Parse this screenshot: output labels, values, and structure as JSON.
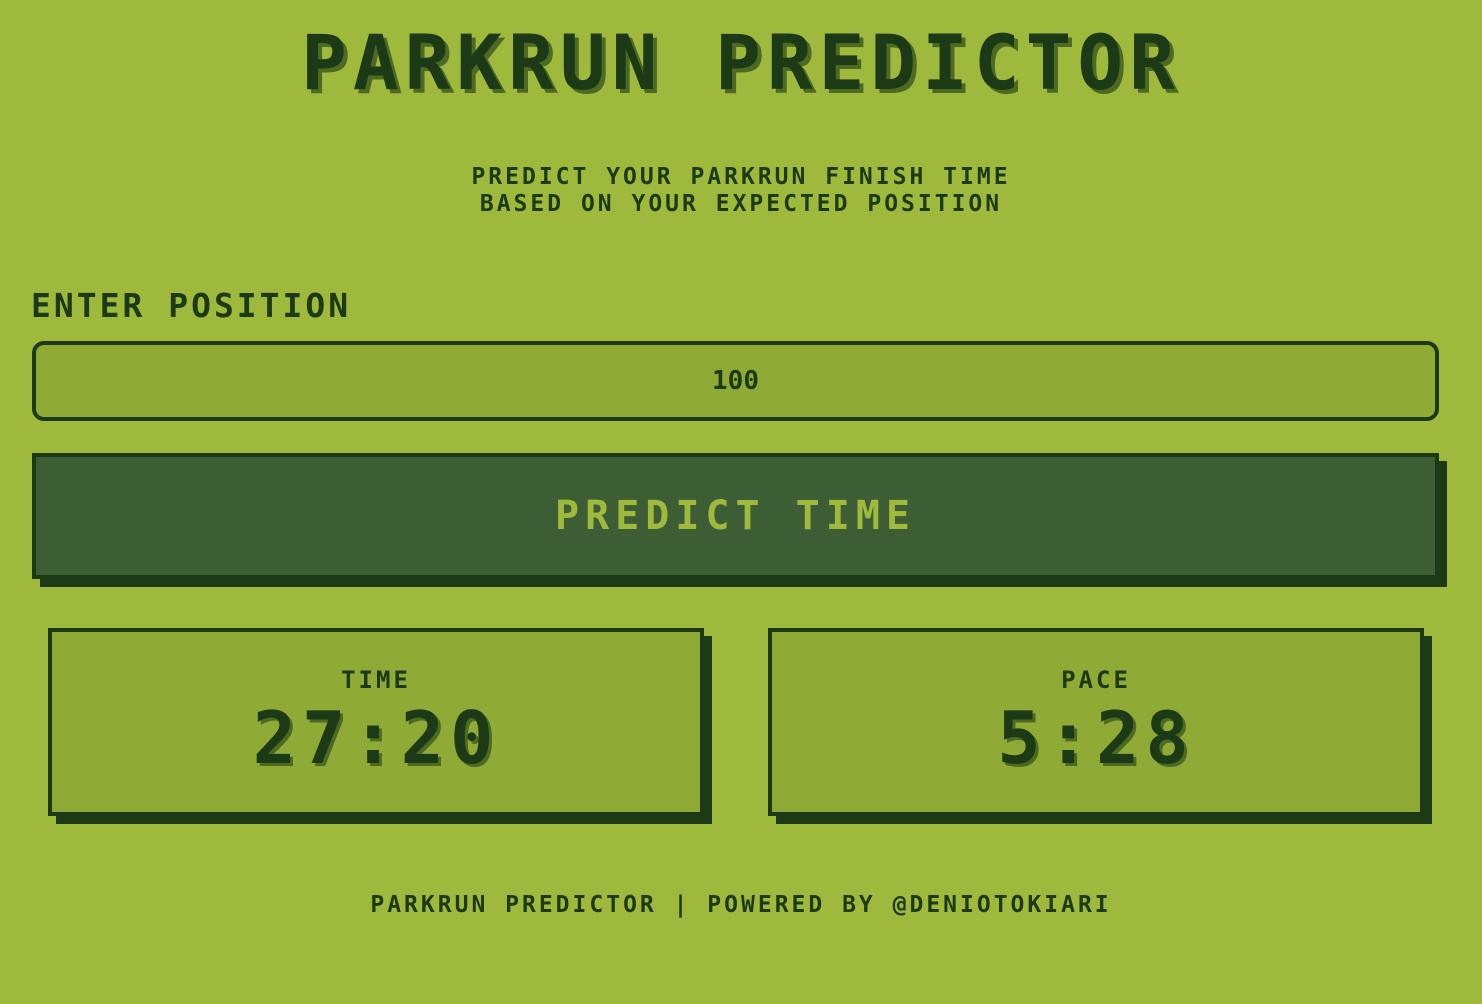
{
  "header": {
    "title": "PARKRUN PREDICTOR",
    "subtitle_line1": "PREDICT YOUR PARKRUN FINISH TIME",
    "subtitle_line2": "BASED ON YOUR EXPECTED POSITION"
  },
  "form": {
    "position_label": "ENTER POSITION",
    "position_value": "100",
    "predict_button_label": "PREDICT TIME"
  },
  "results": {
    "time_label": "TIME",
    "time_value": "27:20",
    "pace_label": "PACE",
    "pace_value": "5:28"
  },
  "footer": {
    "text": "PARKRUN PREDICTOR | POWERED BY @DENIOTOKIARI"
  },
  "colors": {
    "background": "#9fb93d",
    "dark": "#1d3a16",
    "button": "#3d5e34",
    "panel": "#8fab36"
  }
}
